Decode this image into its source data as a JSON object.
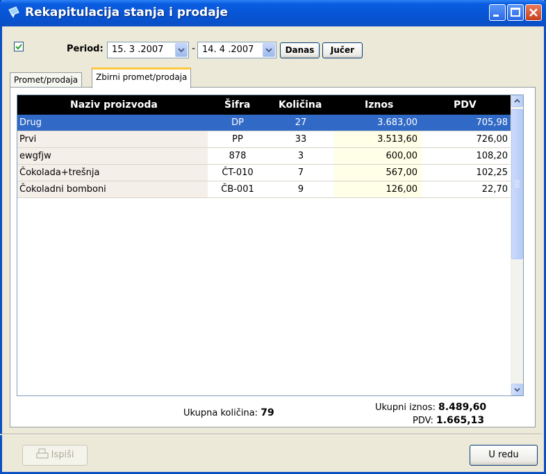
{
  "window": {
    "title": "Rekapitulacija stanja i prodaje"
  },
  "filter": {
    "period_enabled": true,
    "period_label": "Period:",
    "date_from": "15. 3 .2007",
    "separator": "-",
    "date_to": "14. 4 .2007",
    "today_label": "Danas",
    "yesterday_label": "Jučer"
  },
  "tabs": [
    {
      "label": "Promet/prodaja",
      "active": false
    },
    {
      "label": "Zbirni promet/prodaja",
      "active": true
    }
  ],
  "table": {
    "headers": [
      "Naziv proizvoda",
      "Šifra",
      "Količina",
      "Iznos",
      "PDV"
    ],
    "rows": [
      {
        "naziv": "Drug",
        "sifra": "DP",
        "kolicina": "27",
        "iznos": "3.683,00",
        "pdv": "705,98",
        "selected": true
      },
      {
        "naziv": "Prvi",
        "sifra": "PP",
        "kolicina": "33",
        "iznos": "3.513,60",
        "pdv": "726,00"
      },
      {
        "naziv": "ewgfjw",
        "sifra": "878",
        "kolicina": "3",
        "iznos": "600,00",
        "pdv": "108,20"
      },
      {
        "naziv": "Čokolada+trešnja",
        "sifra": "ČT-010",
        "kolicina": "7",
        "iznos": "567,00",
        "pdv": "102,25"
      },
      {
        "naziv": "Čokoladni bomboni",
        "sifra": "ČB-001",
        "kolicina": "9",
        "iznos": "126,00",
        "pdv": "22,70"
      }
    ]
  },
  "totals": {
    "quantity_label": "Ukupna količina:",
    "quantity_value": "79",
    "amount_label": "Ukupni iznos:",
    "amount_value": "8.489,60",
    "vat_label": "PDV:",
    "vat_value": "1.665,13"
  },
  "buttons": {
    "print_label": "Ispiši",
    "ok_label": "U redu"
  },
  "colors": {
    "titlebar": "#0754D4",
    "selection": "#3169C6",
    "tab_accent": "#FFC83C",
    "header_bg": "#000000"
  }
}
